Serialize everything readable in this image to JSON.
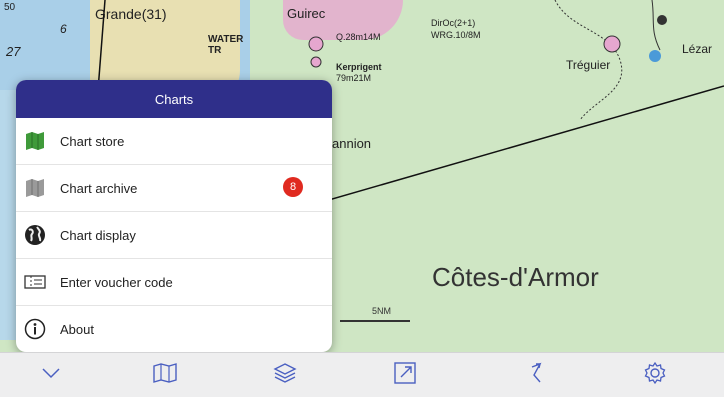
{
  "map": {
    "labels": {
      "grande": "Grande(31)",
      "depth_50": "50",
      "depth_6": "6",
      "depth_27": "27",
      "water_tr": "WATER TR",
      "guirec": "Guirec",
      "dir_oc": "DirOc(2+1)",
      "wrg": "WRG.10/8M",
      "q28": "Q.28m14M",
      "kerprigent": "Kerprigent",
      "depth_79": "79m21M",
      "lannion": "annion",
      "treguier": "Tréguier",
      "lezar": "Lézar"
    },
    "region_label": "Côtes-d'Armor",
    "scale_label": "5NM"
  },
  "popup": {
    "title": "Charts",
    "items": [
      {
        "label": "Chart store",
        "icon": "map-green-icon"
      },
      {
        "label": "Chart archive",
        "icon": "map-gray-icon",
        "badge": "8"
      },
      {
        "label": "Chart display",
        "icon": "globe-icon"
      },
      {
        "label": "Enter voucher code",
        "icon": "ticket-icon"
      },
      {
        "label": "About",
        "icon": "info-icon"
      }
    ]
  },
  "toolbar": {
    "buttons": [
      "chevron-down-icon",
      "map-icon",
      "layers-icon",
      "expand-icon",
      "route-icon",
      "gear-icon"
    ]
  },
  "colors": {
    "header": "#2f2f8a",
    "badge": "#e02a20",
    "toolbar_icon": "#4a5fc1"
  }
}
